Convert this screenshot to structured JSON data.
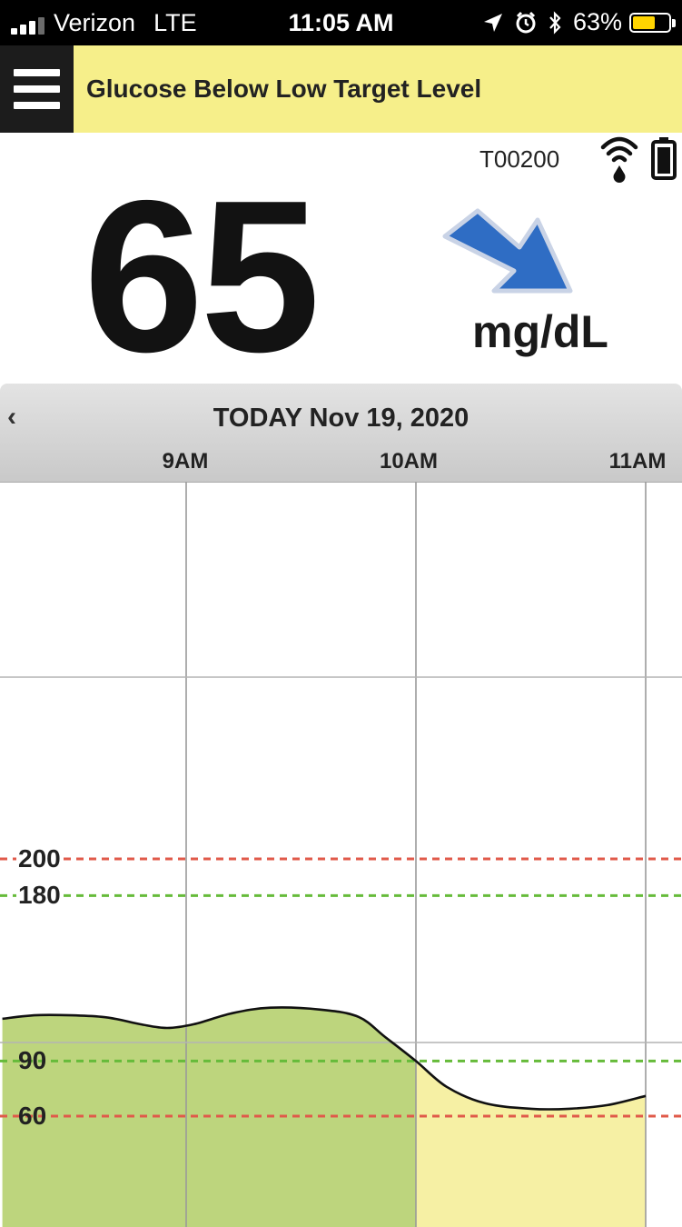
{
  "status_bar": {
    "carrier": "Verizon",
    "network": "LTE",
    "time": "11:05 AM",
    "battery_percent": "63%",
    "battery_level": 0.63,
    "icons": [
      "signal-icon",
      "location-arrow-icon",
      "alarm-clock-icon",
      "bluetooth-icon",
      "battery-icon"
    ]
  },
  "header": {
    "menu_icon": "hamburger-menu-icon",
    "alert_title": "Glucose Below Low Target Level",
    "background_color": "#f6ef8a"
  },
  "sensor": {
    "transmitter_id": "T00200",
    "icons": [
      "signal-drop-icon",
      "sensor-battery-icon"
    ]
  },
  "reading": {
    "value": "65",
    "units": "mg/dL",
    "trend": "falling",
    "trend_icon": "trend-arrow-down-right-icon",
    "trend_color": "#2f6dc4"
  },
  "timeline": {
    "prev_icon": "‹",
    "date_label": "TODAY Nov 19, 2020",
    "hours": [
      "9AM",
      "10AM",
      "11AM"
    ]
  },
  "chart_data": {
    "type": "area",
    "x_unit": "time",
    "x_range": [
      "8:12 AM",
      "11:00 AM"
    ],
    "x_ticks": [
      "9AM",
      "10AM",
      "11AM"
    ],
    "y_tick_labels": [
      "200",
      "180",
      "90",
      "60"
    ],
    "thresholds": [
      {
        "value": 200,
        "color": "#e05a4a",
        "style": "dashed"
      },
      {
        "value": 180,
        "color": "#66bb3a",
        "style": "dashed"
      },
      {
        "value": 90,
        "color": "#66bb3a",
        "style": "dashed"
      },
      {
        "value": 60,
        "color": "#e05a4a",
        "style": "dashed"
      }
    ],
    "series": [
      {
        "points": [
          [
            "8:12",
            113
          ],
          [
            "8:22",
            115
          ],
          [
            "8:38",
            114
          ],
          [
            "8:48",
            110
          ],
          [
            "8:55",
            108
          ],
          [
            "9:02",
            110
          ],
          [
            "9:12",
            116
          ],
          [
            "9:22",
            119
          ],
          [
            "9:35",
            118
          ],
          [
            "9:45",
            114
          ],
          [
            "9:52",
            103
          ],
          [
            "10:00",
            90
          ],
          [
            "10:08",
            76
          ],
          [
            "10:18",
            67
          ],
          [
            "10:30",
            64
          ],
          [
            "10:40",
            64
          ],
          [
            "10:50",
            66
          ],
          [
            "11:00",
            71
          ]
        ]
      }
    ],
    "fill_colors": {
      "in_range": "#bdd57d",
      "low": "#f6f0a4"
    },
    "grid": true
  }
}
